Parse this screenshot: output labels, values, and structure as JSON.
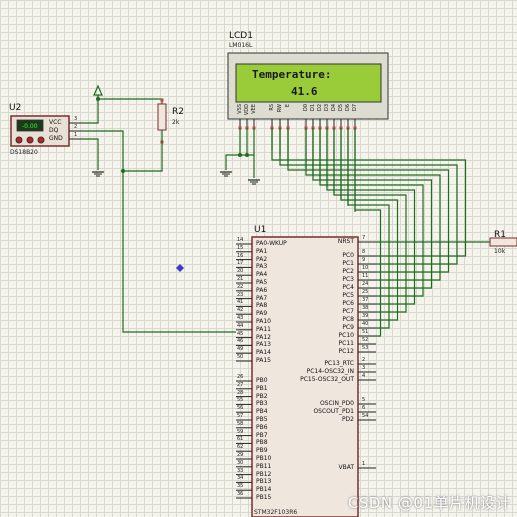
{
  "lcd": {
    "ref": "LCD1",
    "part": "LM016L",
    "line1": "Temperature:",
    "line2": "41.6",
    "pins": [
      "VSS",
      "VDD",
      "VEE",
      "RS",
      "RW",
      "E",
      "D0",
      "D1",
      "D2",
      "D3",
      "D4",
      "D5",
      "D6",
      "D7"
    ]
  },
  "sensor": {
    "ref": "U2",
    "part": "DS18B20",
    "display": "-0.00",
    "pins": [
      "VCC",
      "DQ",
      "GND"
    ],
    "pin_numbers": [
      "3",
      "2",
      "1"
    ]
  },
  "r2": {
    "ref": "R2",
    "value": "2k"
  },
  "r1": {
    "ref": "R1",
    "value": "10k"
  },
  "mcu": {
    "ref": "U1",
    "part": "STM32F103R6",
    "left_pins": [
      {
        "num": "14",
        "name": "PA0-WKUP"
      },
      {
        "num": "15",
        "name": "PA1"
      },
      {
        "num": "16",
        "name": "PA2"
      },
      {
        "num": "17",
        "name": "PA3"
      },
      {
        "num": "20",
        "name": "PA4"
      },
      {
        "num": "21",
        "name": "PA5"
      },
      {
        "num": "22",
        "name": "PA6"
      },
      {
        "num": "23",
        "name": "PA7"
      },
      {
        "num": "41",
        "name": "PA8"
      },
      {
        "num": "42",
        "name": "PA9"
      },
      {
        "num": "43",
        "name": "PA10"
      },
      {
        "num": "44",
        "name": "PA11"
      },
      {
        "num": "45",
        "name": "PA12"
      },
      {
        "num": "46",
        "name": "PA13"
      },
      {
        "num": "49",
        "name": "PA14"
      },
      {
        "num": "50",
        "name": "PA15"
      },
      {
        "num": "26",
        "name": "PB0"
      },
      {
        "num": "27",
        "name": "PB1"
      },
      {
        "num": "28",
        "name": "PB2"
      },
      {
        "num": "55",
        "name": "PB3"
      },
      {
        "num": "56",
        "name": "PB4"
      },
      {
        "num": "57",
        "name": "PB5"
      },
      {
        "num": "58",
        "name": "PB6"
      },
      {
        "num": "59",
        "name": "PB7"
      },
      {
        "num": "61",
        "name": "PB8"
      },
      {
        "num": "62",
        "name": "PB9"
      },
      {
        "num": "29",
        "name": "PB10"
      },
      {
        "num": "30",
        "name": "PB11"
      },
      {
        "num": "33",
        "name": "PB12"
      },
      {
        "num": "34",
        "name": "PB13"
      },
      {
        "num": "35",
        "name": "PB14"
      },
      {
        "num": "36",
        "name": "PB15"
      }
    ],
    "right_pins": [
      {
        "num": "7",
        "name": "NRST"
      },
      {
        "num": "8",
        "name": "PC0"
      },
      {
        "num": "9",
        "name": "PC1"
      },
      {
        "num": "10",
        "name": "PC2"
      },
      {
        "num": "11",
        "name": "PC3"
      },
      {
        "num": "24",
        "name": "PC4"
      },
      {
        "num": "25",
        "name": "PC5"
      },
      {
        "num": "37",
        "name": "PC6"
      },
      {
        "num": "38",
        "name": "PC7"
      },
      {
        "num": "39",
        "name": "PC8"
      },
      {
        "num": "40",
        "name": "PC9"
      },
      {
        "num": "51",
        "name": "PC10"
      },
      {
        "num": "52",
        "name": "PC11"
      },
      {
        "num": "53",
        "name": "PC12"
      },
      {
        "num": "2",
        "name": "PC13_RTC"
      },
      {
        "num": "3",
        "name": "PC14-OSC32_IN"
      },
      {
        "num": "4",
        "name": "PC15-OSC32_OUT"
      },
      {
        "num": "5",
        "name": "OSCIN_PD0"
      },
      {
        "num": "6",
        "name": "OSCOUT_PD1"
      },
      {
        "num": "54",
        "name": "PD2"
      },
      {
        "num": "1",
        "name": "VBAT"
      }
    ]
  },
  "watermark": "CSDN @01单片机设计"
}
